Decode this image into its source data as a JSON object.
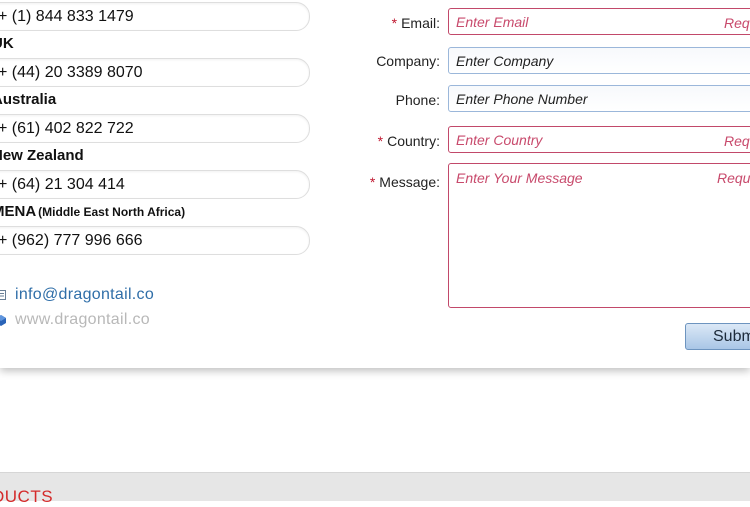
{
  "contacts": {
    "phones": [
      {
        "number": "+ (1) 844 833 1479"
      },
      {
        "number": "+ (44) 20 3389 8070"
      },
      {
        "number": "+ (61) 402 822 722"
      },
      {
        "number": "+ (64) 21 304 414"
      },
      {
        "number": "+ (962) 777 996 666"
      }
    ],
    "regions": [
      {
        "name": "UK"
      },
      {
        "name": "Australia"
      },
      {
        "name": "New Zealand"
      },
      {
        "name": "MENA",
        "sub": "(Middle East North Africa)"
      }
    ],
    "email": "info@dragontail.co",
    "website": "www.dragontail.co",
    "icons": {
      "phone": "phone-icon",
      "email": "envelope-icon",
      "website": "globe-icon"
    }
  },
  "form": {
    "required_mark": "*",
    "required_tag": "Req",
    "required_tag_message": "Requ",
    "email": {
      "label": "Email:",
      "placeholder": "Enter Email"
    },
    "company": {
      "label": "Company:",
      "placeholder": "Enter Company"
    },
    "phone": {
      "label": "Phone:",
      "placeholder": "Enter Phone Number"
    },
    "country": {
      "label": "Country:",
      "placeholder": "Enter Country"
    },
    "message": {
      "label": "Message:",
      "placeholder": "Enter Your Message"
    },
    "submit_label": "Subm"
  },
  "footer": {
    "title": "DUCTS"
  },
  "colors": {
    "required": "#c01830",
    "link": "#2f6ea8",
    "footer_title": "#d42a2a"
  }
}
